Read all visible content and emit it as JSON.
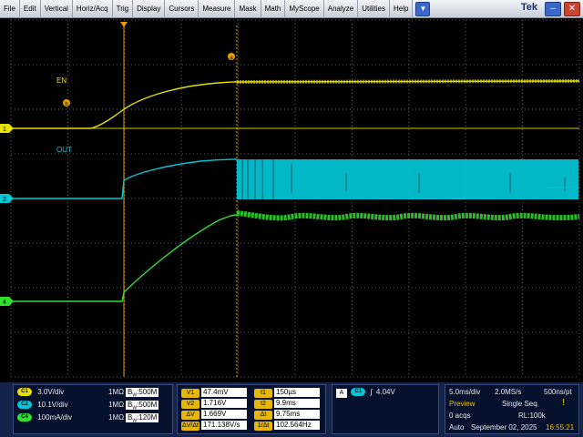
{
  "menu": {
    "items": [
      "File",
      "Edit",
      "Vertical",
      "Horiz/Acq",
      "Trig",
      "Display",
      "Cursors",
      "Measure",
      "Mask",
      "Math",
      "MyScope",
      "Analyze",
      "Utilities",
      "Help"
    ],
    "brand": "Tek",
    "dropdown_glyph": "▼",
    "minimize_glyph": "–",
    "close_glyph": "✕"
  },
  "screen": {
    "trace_labels": {
      "en": "EN",
      "out": "OUT"
    },
    "marker_a": "a",
    "marker_b": "b",
    "channel_markers": [
      "1",
      "2",
      "4"
    ]
  },
  "channels": [
    {
      "id": "C1",
      "scale": "3.0V/div",
      "impedance": "1MΩ",
      "bw_prefix": "B",
      "bw_sub": "W",
      "bw": ":500M",
      "color": "#e8e000"
    },
    {
      "id": "C2",
      "scale": "10.1V/div",
      "impedance": "1MΩ",
      "bw_prefix": "B",
      "bw_sub": "W",
      "bw": ":500M",
      "color": "#00c8d8"
    },
    {
      "id": "C4",
      "scale": "100mA/div",
      "impedance": "1MΩ",
      "bw_prefix": "B",
      "bw_sub": "W",
      "bw": ":120M",
      "color": "#30e030"
    }
  ],
  "cursors": {
    "left": [
      {
        "tag": "V1",
        "value": "47.4mV"
      },
      {
        "tag": "V2",
        "value": "1.716V"
      },
      {
        "tag": "ΔV",
        "value": "1.669V"
      },
      {
        "tag": "ΔV/Δt",
        "value": "171.138V/s"
      }
    ],
    "right": [
      {
        "tag": "t1",
        "value": "150µs"
      },
      {
        "tag": "t2",
        "value": "9.9ms"
      },
      {
        "tag": "Δt",
        "value": "9.75ms"
      },
      {
        "tag": "1/Δt",
        "value": "102.564Hz"
      }
    ]
  },
  "trigger": {
    "mode": "A",
    "source": "C1",
    "slope_glyph": "∫",
    "level": "4.04V"
  },
  "acquisition": {
    "timebase": "5.0ms/div",
    "sample_rate": "2.0MS/s",
    "resolution": "500ns/pt",
    "state": "Preview",
    "mode": "Single Seq",
    "acqs": "0 acqs",
    "record_length": "RL:100k",
    "horizontal_mode": "Auto",
    "date": "September 02, 2025",
    "time": "16:55:21"
  },
  "colors": {
    "ch1": "#e8e000",
    "ch2": "#00c8d8",
    "ch4": "#30e030",
    "cursor": "#e8a000",
    "grid": "#5a5a5a"
  }
}
